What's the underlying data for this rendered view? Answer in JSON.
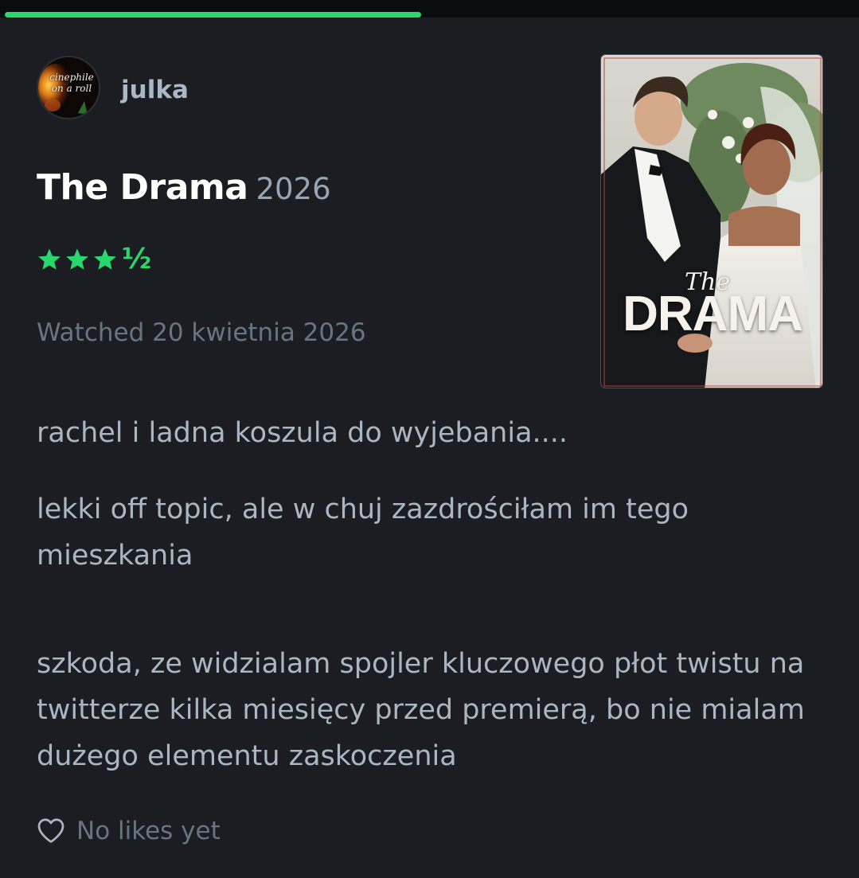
{
  "progress": {
    "fraction": 0.49,
    "color": "#28d86d"
  },
  "user": {
    "name": "julka",
    "avatar_text_line1": "cinephile",
    "avatar_text_line2": "on a roll"
  },
  "film": {
    "title": "The Drama",
    "year": "2026",
    "poster_title_small": "The",
    "poster_title_large": "DRAMA"
  },
  "rating": {
    "stars": 3.5,
    "full_stars": 3,
    "half_label": "½",
    "color": "#28d86d"
  },
  "watched": "Watched 20 kwietnia 2026",
  "review": {
    "paragraphs": [
      "rachel i ladna koszula do wyjebania....",
      "lekki off topic, ale w chuj zazdrościłam im tego mieszkania",
      "szkoda, ze widzialam spojler kluczowego płot twistu na twitterze kilka miesięcy przed premierą, bo nie mialam dużego elementu zaskoczenia"
    ]
  },
  "likes": {
    "icon": "heart-icon",
    "text": "No likes yet"
  }
}
